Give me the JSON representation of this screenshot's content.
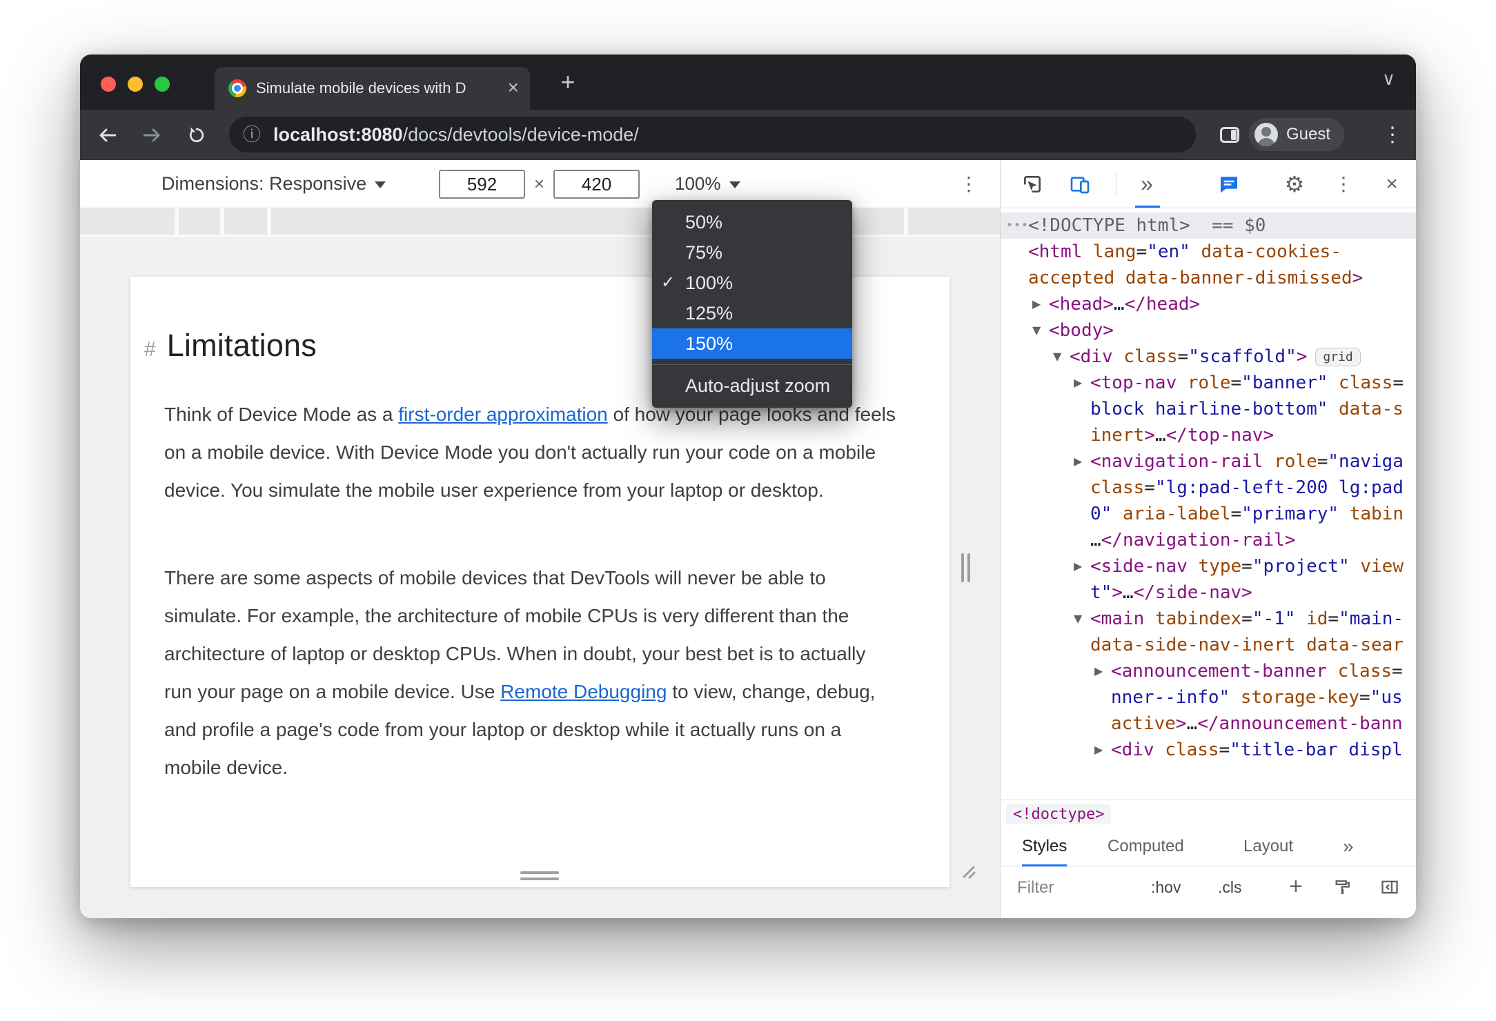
{
  "browser": {
    "tab_title": "Simulate mobile devices with D",
    "url_host": "localhost:8080",
    "url_path": "/docs/devtools/device-mode/",
    "profile_label": "Guest"
  },
  "device_toolbar": {
    "dimensions_label": "Dimensions: Responsive",
    "width_value": "592",
    "separator": "×",
    "height_value": "420",
    "zoom_value": "100%"
  },
  "zoom_menu": {
    "items": [
      {
        "label": "50%"
      },
      {
        "label": "75%"
      },
      {
        "label": "100%",
        "checked": true
      },
      {
        "label": "125%"
      },
      {
        "label": "150%",
        "highlighted": true
      }
    ],
    "auto_item": "Auto-adjust zoom"
  },
  "page": {
    "heading_anchor": "#",
    "heading": "Limitations",
    "paragraph1": {
      "before": "Think of Device Mode as a ",
      "link": "first-order approximation",
      "after": " of how your page looks and feels on a mobile device. With Device Mode you don't actually run your code on a mobile device. You simulate the mobile user experience from your laptop or desktop."
    },
    "paragraph2": {
      "before": "There are some aspects of mobile devices that DevTools will never be able to simulate. For example, the architecture of mobile CPUs is very different than the architecture of laptop or desktop CPUs. When in doubt, your best bet is to actually run your page on a mobile device. Use ",
      "link": "Remote Debugging",
      "after": " to view, change, debug, and profile a page's code from your laptop or desktop while it actually runs on a mobile device."
    }
  },
  "devtools": {
    "breadcrumb": "<!doctype>",
    "tabs": [
      {
        "label": "Styles",
        "active": true
      },
      {
        "label": "Computed"
      },
      {
        "label": "Layout"
      }
    ],
    "filter_placeholder": "Filter",
    "hov_label": ":hov",
    "cls_label": ".cls",
    "plus_label": "+",
    "dom_lines": [
      {
        "indent": 0,
        "arrow": "none",
        "selected": true,
        "dots": true,
        "segs": [
          [
            "doctype",
            "<!DOCTYPE html>"
          ],
          [
            "eq",
            "  == $0"
          ]
        ]
      },
      {
        "indent": 0,
        "arrow": "none",
        "segs": [
          [
            "tag",
            "<html"
          ],
          [
            "attr",
            " lang"
          ],
          [
            "plain",
            "="
          ],
          [
            "val",
            "\"en\""
          ],
          [
            "attr",
            " data-cookies-"
          ]
        ]
      },
      {
        "indent": 0,
        "cont": true,
        "segs": [
          [
            "attr",
            "accepted data-banner-dismissed"
          ],
          [
            "tag",
            ">"
          ]
        ]
      },
      {
        "indent": 1,
        "arrow": "closed",
        "segs": [
          [
            "tag",
            "<head>"
          ],
          [
            "plain",
            "…"
          ],
          [
            "tag",
            "</head>"
          ]
        ]
      },
      {
        "indent": 1,
        "arrow": "open",
        "segs": [
          [
            "tag",
            "<body>"
          ]
        ]
      },
      {
        "indent": 2,
        "arrow": "open",
        "badge": "grid",
        "segs": [
          [
            "tag",
            "<div"
          ],
          [
            "attr",
            " class"
          ],
          [
            "plain",
            "="
          ],
          [
            "val",
            "\"scaffold\""
          ],
          [
            "tag",
            ">"
          ]
        ]
      },
      {
        "indent": 3,
        "arrow": "closed",
        "segs": [
          [
            "tag",
            "<top-nav"
          ],
          [
            "attr",
            " role"
          ],
          [
            "plain",
            "="
          ],
          [
            "val",
            "\"banner\""
          ],
          [
            "attr",
            " class"
          ],
          [
            "plain",
            "="
          ]
        ]
      },
      {
        "indent": 3,
        "cont": true,
        "segs": [
          [
            "val",
            "block hairline-bottom\""
          ],
          [
            "attr",
            " data-s"
          ]
        ]
      },
      {
        "indent": 3,
        "cont": true,
        "segs": [
          [
            "attr",
            "inert"
          ],
          [
            "tag",
            ">"
          ],
          [
            "plain",
            "…"
          ],
          [
            "tag",
            "</top-nav>"
          ]
        ]
      },
      {
        "indent": 3,
        "arrow": "closed",
        "segs": [
          [
            "tag",
            "<navigation-rail"
          ],
          [
            "attr",
            " role"
          ],
          [
            "plain",
            "="
          ],
          [
            "val",
            "\"naviga"
          ]
        ]
      },
      {
        "indent": 3,
        "cont": true,
        "segs": [
          [
            "attr",
            "class"
          ],
          [
            "plain",
            "="
          ],
          [
            "val",
            "\"lg:pad-left-200 lg:pad"
          ]
        ]
      },
      {
        "indent": 3,
        "cont": true,
        "segs": [
          [
            "val",
            "0\""
          ],
          [
            "attr",
            " aria-label"
          ],
          [
            "plain",
            "="
          ],
          [
            "val",
            "\"primary\""
          ],
          [
            "attr",
            " tabin"
          ]
        ]
      },
      {
        "indent": 3,
        "cont": true,
        "segs": [
          [
            "plain",
            "…"
          ],
          [
            "tag",
            "</navigation-rail>"
          ]
        ]
      },
      {
        "indent": 3,
        "arrow": "closed",
        "segs": [
          [
            "tag",
            "<side-nav"
          ],
          [
            "attr",
            " type"
          ],
          [
            "plain",
            "="
          ],
          [
            "val",
            "\"project\""
          ],
          [
            "attr",
            " view"
          ]
        ]
      },
      {
        "indent": 3,
        "cont": true,
        "segs": [
          [
            "val",
            "t\""
          ],
          [
            "tag",
            ">"
          ],
          [
            "plain",
            "…"
          ],
          [
            "tag",
            "</side-nav>"
          ]
        ]
      },
      {
        "indent": 3,
        "arrow": "open",
        "segs": [
          [
            "tag",
            "<main"
          ],
          [
            "attr",
            " tabindex"
          ],
          [
            "plain",
            "="
          ],
          [
            "val",
            "\"-1\""
          ],
          [
            "attr",
            " id"
          ],
          [
            "plain",
            "="
          ],
          [
            "val",
            "\"main-"
          ]
        ]
      },
      {
        "indent": 3,
        "cont": true,
        "segs": [
          [
            "attr",
            "data-side-nav-inert data-sear"
          ]
        ]
      },
      {
        "indent": 4,
        "arrow": "closed",
        "segs": [
          [
            "tag",
            "<announcement-banner"
          ],
          [
            "attr",
            " class"
          ],
          [
            "plain",
            "="
          ]
        ]
      },
      {
        "indent": 4,
        "cont": true,
        "segs": [
          [
            "val",
            "nner--info\""
          ],
          [
            "attr",
            " storage-key"
          ],
          [
            "plain",
            "="
          ],
          [
            "val",
            "\"us"
          ]
        ]
      },
      {
        "indent": 4,
        "cont": true,
        "segs": [
          [
            "attr",
            "active"
          ],
          [
            "tag",
            ">"
          ],
          [
            "plain",
            "…"
          ],
          [
            "tag",
            "</announcement-bann"
          ]
        ]
      },
      {
        "indent": 4,
        "arrow": "closed",
        "segs": [
          [
            "tag",
            "<div"
          ],
          [
            "attr",
            " class"
          ],
          [
            "plain",
            "="
          ],
          [
            "val",
            "\"title-bar displ"
          ]
        ]
      }
    ]
  },
  "icons": {
    "close-icon": "×",
    "plus-icon": "+",
    "chevron-down-icon": "∨",
    "info-icon": "ⓘ",
    "menu-dots-icon": "⋮",
    "gear-icon": "⚙",
    "more-tabs-icon": "»",
    "check-icon": "✓",
    "collapsed-arrow-icon": "▶",
    "expanded-arrow-icon": "▼",
    "node-dots-icon": "•••"
  },
  "colors": {
    "accent_blue": "#1a73e8",
    "link_blue": "#1967d2",
    "code_tag": "#881280",
    "code_attribute": "#994500",
    "code_value": "#1a1aa6",
    "traffic_red": "#ff5f57",
    "traffic_yellow": "#febc2e",
    "traffic_green": "#28c840"
  }
}
